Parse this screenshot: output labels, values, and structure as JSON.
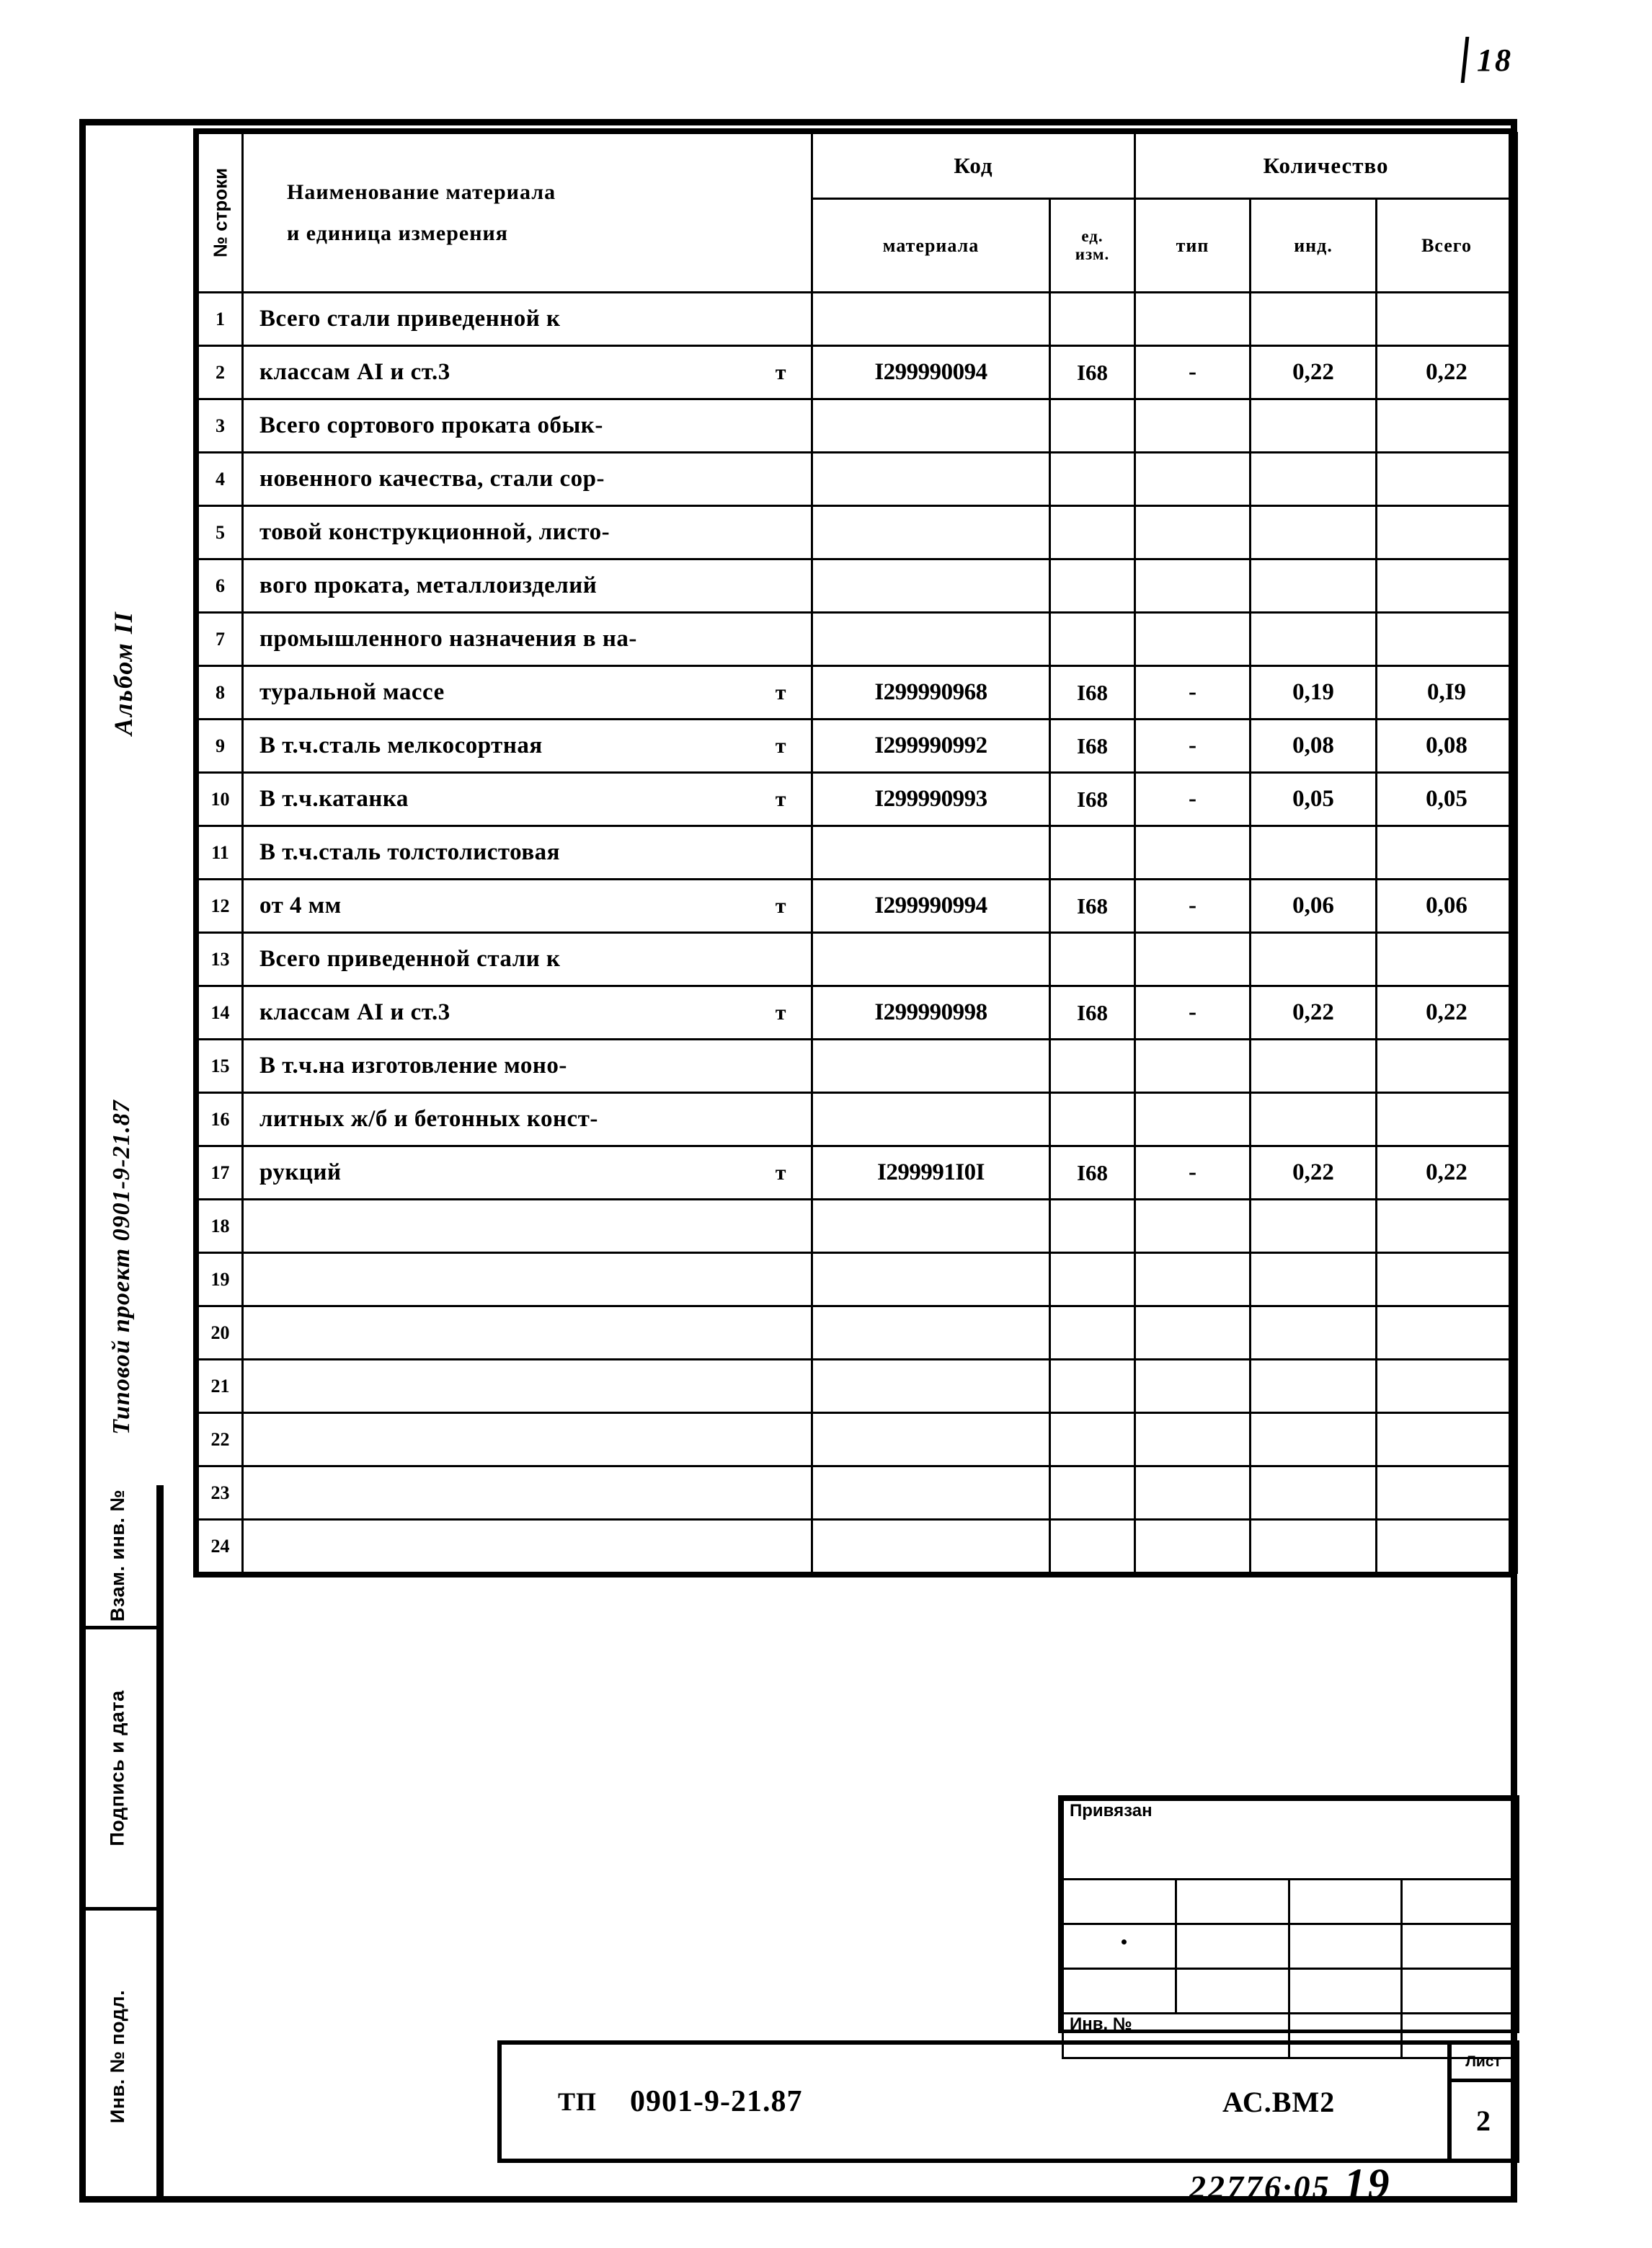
{
  "page": {
    "corner_number": "18",
    "archive_number": "22776·05",
    "archive_suffix": "19"
  },
  "side_captions": {
    "album": "Альбом II",
    "project": "Типовой проект 0901-9-21.87"
  },
  "margin_stamps": [
    {
      "label": "Взам. инв. №"
    },
    {
      "label": "Подпись и дата"
    },
    {
      "label": "Инв. № подл."
    }
  ],
  "table": {
    "headers": {
      "row_number": "№ строки",
      "name_line1": "Наименование материала",
      "name_line2": "и единица  измерения",
      "code_group": "Код",
      "code_material": "материала",
      "code_unit_line1": "ед.",
      "code_unit_line2": "изм.",
      "qty_group": "Количество",
      "qty_type": "тип",
      "qty_ind": "инд.",
      "qty_total": "Всего"
    },
    "rows": [
      {
        "n": "1",
        "name": "Всего стали приведенной к",
        "unit_in_name": "",
        "code": "",
        "unit": "",
        "type": "",
        "ind": "",
        "total": ""
      },
      {
        "n": "2",
        "name": "классам АI и ст.3",
        "unit_in_name": "т",
        "code": "I299990094",
        "unit": "I68",
        "type": "-",
        "ind": "0,22",
        "total": "0,22"
      },
      {
        "n": "3",
        "name": "Всего сортового проката обык-",
        "unit_in_name": "",
        "code": "",
        "unit": "",
        "type": "",
        "ind": "",
        "total": ""
      },
      {
        "n": "4",
        "name": "новенного качества, стали сор-",
        "unit_in_name": "",
        "code": "",
        "unit": "",
        "type": "",
        "ind": "",
        "total": ""
      },
      {
        "n": "5",
        "name": "товой конструкционной, листо-",
        "unit_in_name": "",
        "code": "",
        "unit": "",
        "type": "",
        "ind": "",
        "total": ""
      },
      {
        "n": "6",
        "name": "вого проката, металлоизделий",
        "unit_in_name": "",
        "code": "",
        "unit": "",
        "type": "",
        "ind": "",
        "total": ""
      },
      {
        "n": "7",
        "name": "промышленного назначения в на-",
        "unit_in_name": "",
        "code": "",
        "unit": "",
        "type": "",
        "ind": "",
        "total": ""
      },
      {
        "n": "8",
        "name": "туральной массе",
        "unit_in_name": "т",
        "code": "I299990968",
        "unit": "I68",
        "type": "-",
        "ind": "0,19",
        "total": "0,I9"
      },
      {
        "n": "9",
        "name": "В т.ч.сталь мелкосортная",
        "unit_in_name": "т",
        "code": "I299990992",
        "unit": "I68",
        "type": "-",
        "ind": "0,08",
        "total": "0,08"
      },
      {
        "n": "10",
        "name": "В т.ч.катанка",
        "unit_in_name": "т",
        "code": "I299990993",
        "unit": "I68",
        "type": "-",
        "ind": "0,05",
        "total": "0,05"
      },
      {
        "n": "11",
        "name": "В т.ч.сталь толстолистовая",
        "unit_in_name": "",
        "code": "",
        "unit": "",
        "type": "",
        "ind": "",
        "total": ""
      },
      {
        "n": "12",
        "name": "от 4 мм",
        "unit_in_name": "т",
        "code": "I299990994",
        "unit": "I68",
        "type": "-",
        "ind": "0,06",
        "total": "0,06"
      },
      {
        "n": "13",
        "name": "Всего приведенной стали к",
        "unit_in_name": "",
        "code": "",
        "unit": "",
        "type": "",
        "ind": "",
        "total": ""
      },
      {
        "n": "14",
        "name": "классам АI и ст.3",
        "unit_in_name": "т",
        "code": "I299990998",
        "unit": "I68",
        "type": "-",
        "ind": "0,22",
        "total": "0,22"
      },
      {
        "n": "15",
        "name": "В т.ч.на изготовление моно-",
        "unit_in_name": "",
        "code": "",
        "unit": "",
        "type": "",
        "ind": "",
        "total": ""
      },
      {
        "n": "16",
        "name": "литных ж/б и бетонных конст-",
        "unit_in_name": "",
        "code": "",
        "unit": "",
        "type": "",
        "ind": "",
        "total": ""
      },
      {
        "n": "17",
        "name": "рукций",
        "unit_in_name": "т",
        "code": "I299991I0I",
        "unit": "I68",
        "type": "-",
        "ind": "0,22",
        "total": "0,22"
      },
      {
        "n": "18",
        "name": "",
        "unit_in_name": "",
        "code": "",
        "unit": "",
        "type": "",
        "ind": "",
        "total": ""
      },
      {
        "n": "19",
        "name": "",
        "unit_in_name": "",
        "code": "",
        "unit": "",
        "type": "",
        "ind": "",
        "total": ""
      },
      {
        "n": "20",
        "name": "",
        "unit_in_name": "",
        "code": "",
        "unit": "",
        "type": "",
        "ind": "",
        "total": ""
      },
      {
        "n": "21",
        "name": "",
        "unit_in_name": "",
        "code": "",
        "unit": "",
        "type": "",
        "ind": "",
        "total": ""
      },
      {
        "n": "22",
        "name": "",
        "unit_in_name": "",
        "code": "",
        "unit": "",
        "type": "",
        "ind": "",
        "total": ""
      },
      {
        "n": "23",
        "name": "",
        "unit_in_name": "",
        "code": "",
        "unit": "",
        "type": "",
        "ind": "",
        "total": ""
      },
      {
        "n": "24",
        "name": "",
        "unit_in_name": "",
        "code": "",
        "unit": "",
        "type": "",
        "ind": "",
        "total": ""
      }
    ]
  },
  "privyazan_stamp": {
    "title": "Привязан",
    "inv_label": "Инв. №"
  },
  "title_block": {
    "tp_prefix": "ТП",
    "project_code": "0901-9-21.87",
    "mark": "АС.ВМ2",
    "sheet_label": "Лист",
    "sheet_value": "2"
  }
}
